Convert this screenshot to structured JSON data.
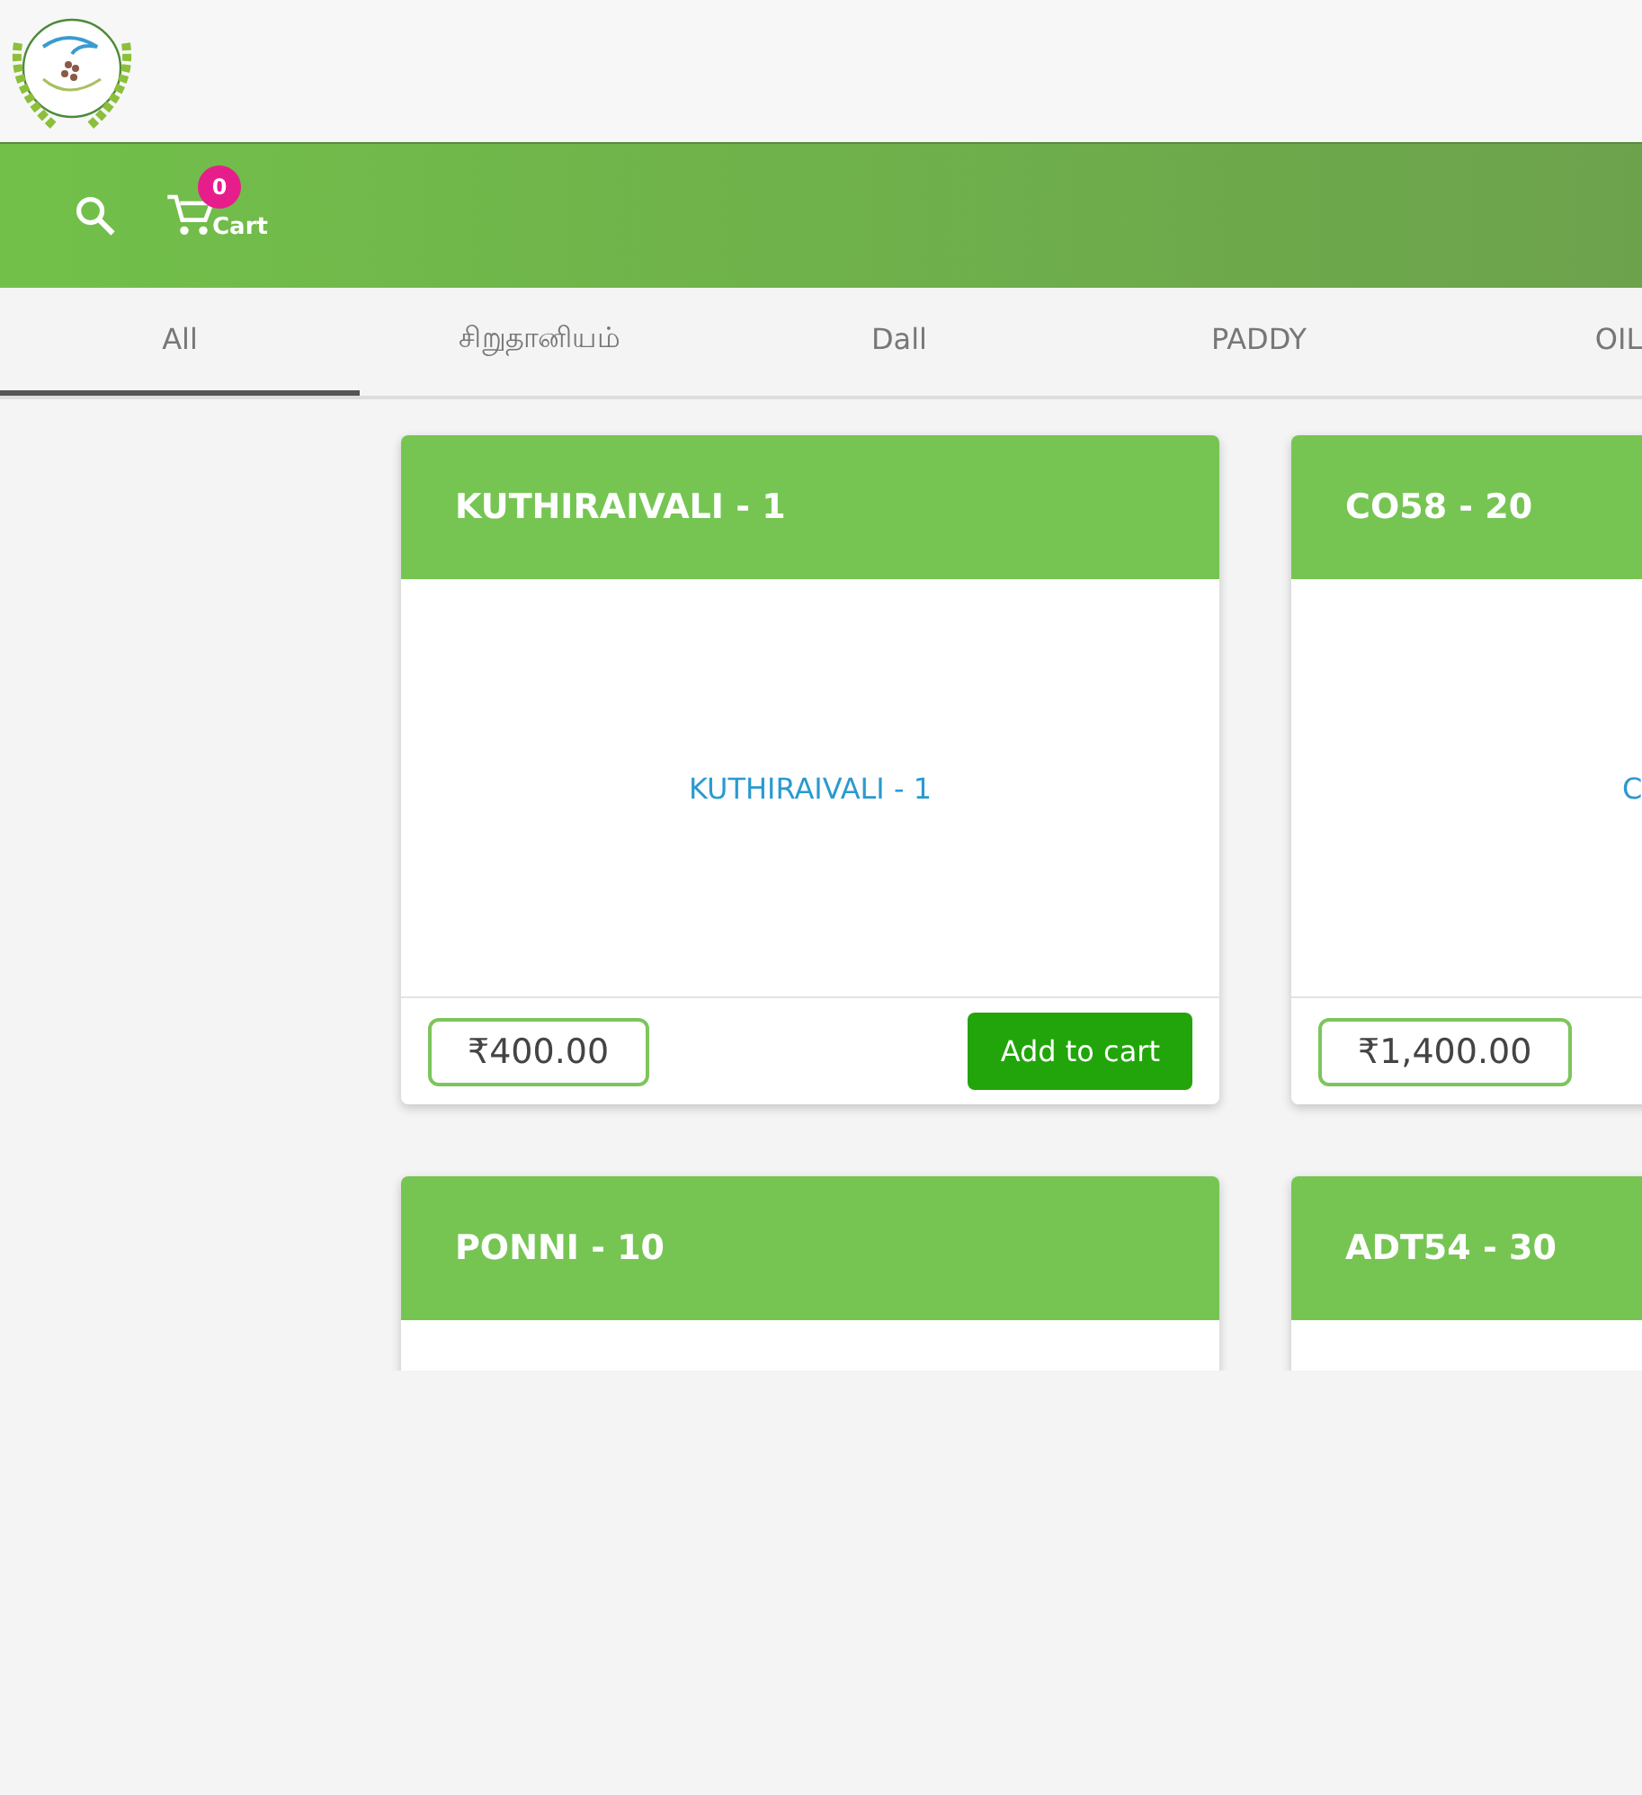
{
  "toolbar": {
    "cart_label": "Cart",
    "cart_count": "0"
  },
  "tabs": [
    {
      "label": "All",
      "selected": true
    },
    {
      "label": "சிறுதானியம்",
      "selected": false
    },
    {
      "label": "Dall",
      "selected": false
    },
    {
      "label": "PADDY",
      "selected": false
    },
    {
      "label": "OIL",
      "selected": false
    }
  ],
  "products": [
    {
      "title": "KUTHIRAIVALI - 1",
      "image_label": "KUTHIRAIVALI - 1",
      "price": "₹400.00",
      "button": "Add to cart"
    },
    {
      "title": "CO58 - 20",
      "image_label": "C",
      "price": "₹1,400.00"
    },
    {
      "title": "PONNI - 10"
    },
    {
      "title": "ADT54 - 30"
    }
  ]
}
